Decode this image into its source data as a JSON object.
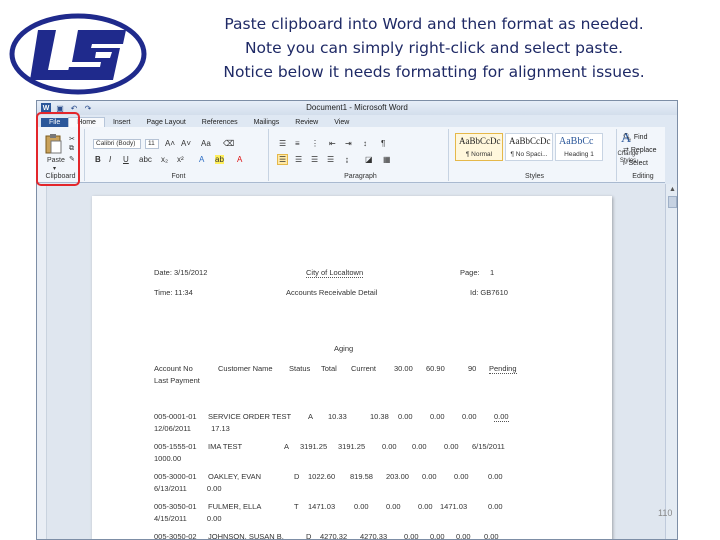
{
  "slide": {
    "lines": [
      "Paste clipboard into Word and then format as needed.",
      "Note you can simply right-click and select paste.",
      "Notice below it needs formatting for alignment issues."
    ],
    "page_number": "110"
  },
  "colors": {
    "logo": "#1f2a8c",
    "highlight": "#e3262b",
    "file_tab": "#2b579a"
  },
  "window": {
    "title": "Document1 - Microsoft Word",
    "qat_icons": [
      "word-logo-icon",
      "save-icon",
      "undo-icon",
      "redo-icon"
    ]
  },
  "tabs": [
    "File",
    "Home",
    "Insert",
    "Page Layout",
    "References",
    "Mailings",
    "Review",
    "View"
  ],
  "ribbon": {
    "clipboard": {
      "paste": "Paste",
      "label": "Clipboard"
    },
    "font": {
      "name": "Calibri (Body)",
      "size": "11",
      "label": "Font",
      "bold": "B",
      "italic": "I",
      "underline": "U"
    },
    "paragraph": {
      "label": "Paragraph",
      "pilcrow": "¶"
    },
    "styles": {
      "label": "Styles",
      "items": [
        {
          "sample": "AaBbCcDc",
          "name": "¶ Normal"
        },
        {
          "sample": "AaBbCcDc",
          "name": "¶ No Spaci..."
        },
        {
          "sample": "AaBbCc",
          "name": "Heading 1"
        }
      ],
      "change_styles": "Change Styles"
    },
    "editing": {
      "find": "Find",
      "replace": "Replace",
      "select": "Select",
      "label": "Editing"
    }
  },
  "document": {
    "date": "Date: 3/15/2012",
    "city": "City of Localtown",
    "page": "Page:",
    "page_num": "1",
    "time": "Time: 11:34",
    "report": "Accounts Receivable Detail",
    "id": "Id: GB7610",
    "aging": "Aging",
    "headers": [
      "Account No",
      "Customer Name",
      "Status",
      "Total",
      "Current",
      "30.00",
      "60.90",
      "90",
      "Pending"
    ],
    "header2": "Last Payment",
    "rows": [
      {
        "line1": [
          "005-0001-01",
          "SERVICE ORDER TEST",
          "A",
          "10.33",
          "10.38",
          "0.00",
          "0.00",
          "0.00",
          "0.00"
        ],
        "line2": "12/06/2011  17.13"
      },
      {
        "line1": [
          "005-1555-01",
          "IMA TEST",
          "A",
          "3191.25",
          "3191.25",
          "0.00",
          "0.00",
          "0.00",
          "6/15/2011"
        ],
        "line2": "1000.00"
      },
      {
        "line1": [
          "005-3000-01",
          "OAKLEY, EVAN",
          "D",
          "1022.60",
          "819.58",
          "203.00",
          "0.00",
          "0.00",
          "0.00"
        ],
        "line2": "6/13/2011  0.00"
      },
      {
        "line1": [
          "005-3050-01",
          "FULMER, ELLA",
          "T",
          "1471.03",
          "0.00",
          "0.00",
          "0.00",
          "1471.03",
          "0.00"
        ],
        "line2": "4/15/2011  0.00"
      },
      {
        "line1": [
          "005-3050-02",
          "JOHNSON, SUSAN B.",
          "D",
          "4270.32",
          "4270.33",
          "0.00",
          "0.00",
          "0.00",
          "0.00"
        ],
        "line2": ""
      }
    ]
  }
}
